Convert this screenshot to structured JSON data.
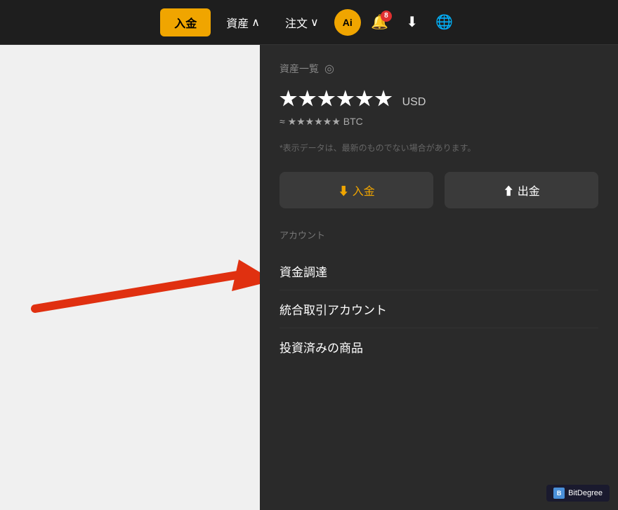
{
  "navbar": {
    "deposit_label": "入金",
    "assets_label": "資産",
    "orders_label": "注文",
    "notification_count": "8",
    "user_initial": "Ai"
  },
  "dropdown": {
    "overview_label": "資産一覧",
    "masked_value": "★★★★★★",
    "currency": "USD",
    "btc_prefix": "≈ ★★★★★★",
    "btc_label": "BTC",
    "disclaimer": "*表示データは、最新のものでない場合があります。",
    "btn_deposit": "⬇ 入金",
    "btn_withdraw": "⬆ 出金",
    "section_account": "アカウント",
    "menu_item_1": "資金調達",
    "menu_item_2": "統合取引アカウント",
    "menu_item_3": "投資済みの商品"
  },
  "bitdegree": {
    "label": "BitDegree"
  }
}
